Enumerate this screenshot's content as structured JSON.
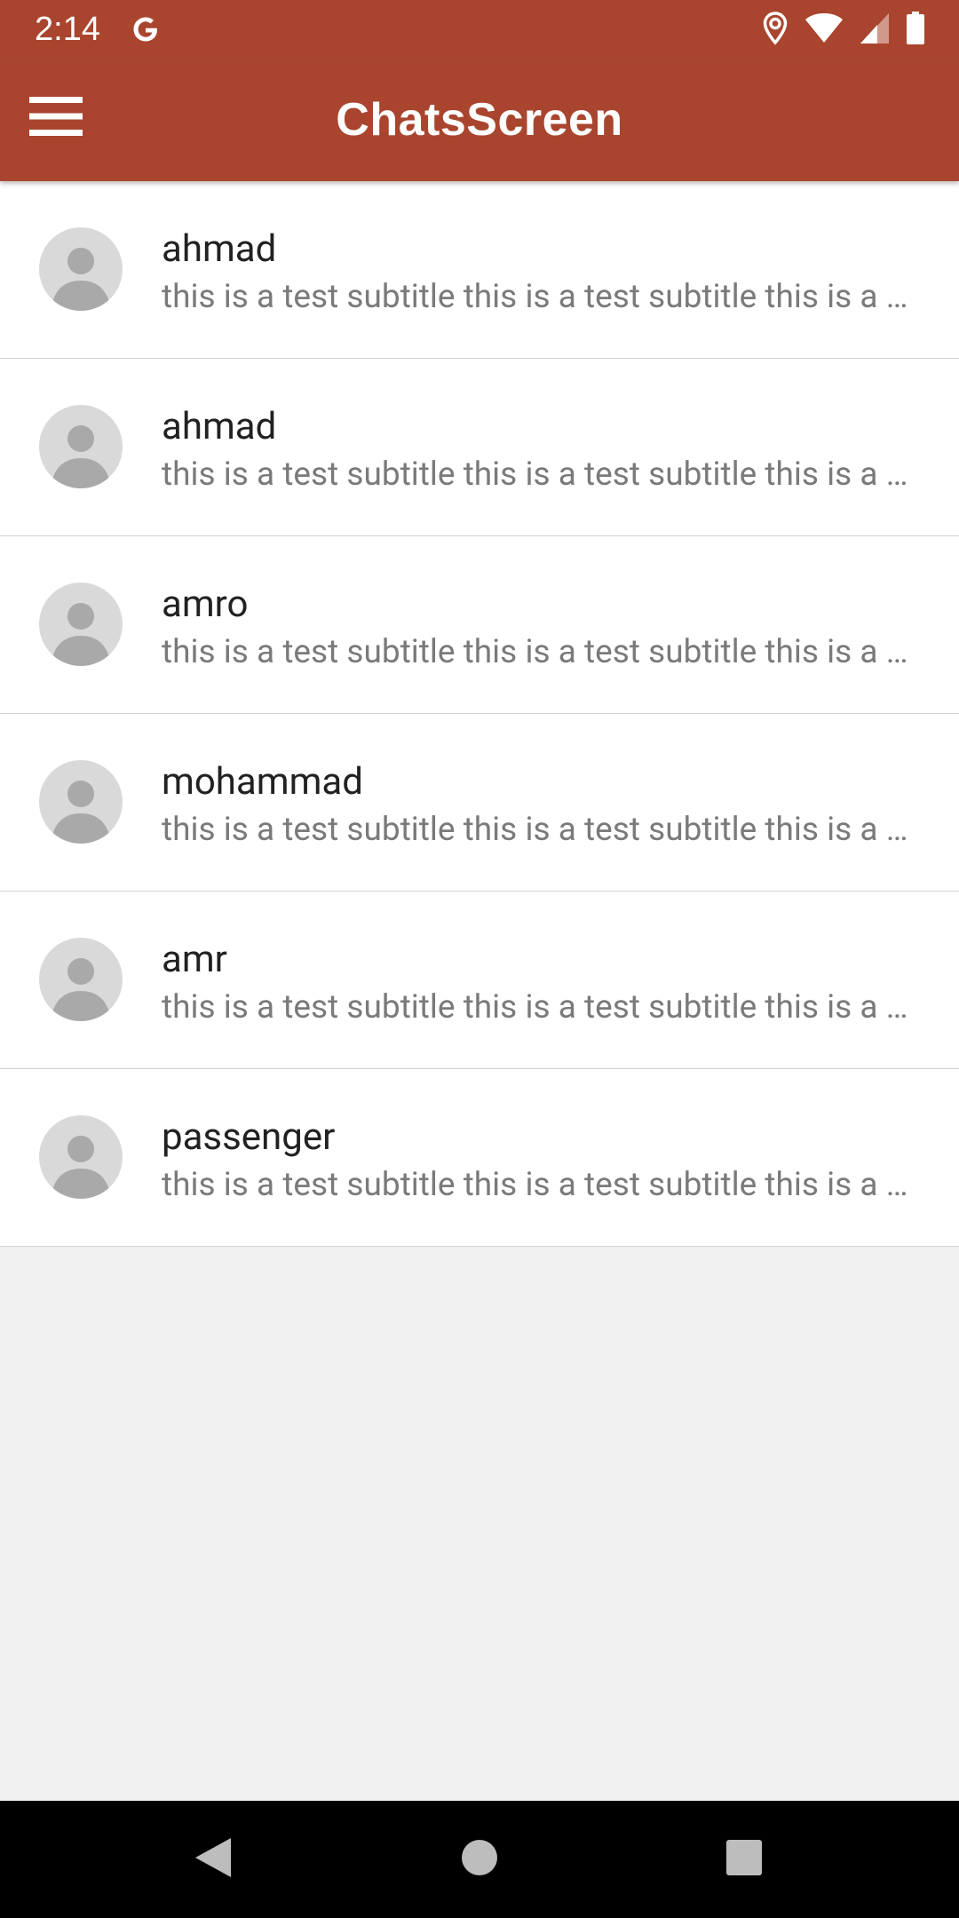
{
  "status_bar": {
    "time": "2:14",
    "google_icon": "google-g-icon",
    "icons": [
      "location-icon",
      "wifi-icon",
      "cellular-signal-icon",
      "battery-icon"
    ]
  },
  "app_bar": {
    "title": "ChatsScreen",
    "menu_icon": "hamburger-menu-icon",
    "background_color": "#a9452e"
  },
  "chats": [
    {
      "name": "ahmad",
      "subtitle": "this is a test subtitle this is a test subtitle this is a test subtitle"
    },
    {
      "name": "ahmad",
      "subtitle": "this is a test subtitle this is a test subtitle this is a test subtitle"
    },
    {
      "name": "amro",
      "subtitle": "this is a test subtitle this is a test subtitle this is a test subtitle"
    },
    {
      "name": "mohammad",
      "subtitle": "this is a test subtitle this is a test subtitle this is a test subtitle"
    },
    {
      "name": "amr",
      "subtitle": "this is a test subtitle this is a test subtitle this is a test subtitle"
    },
    {
      "name": "passenger",
      "subtitle": "this is a test subtitle this is a test subtitle this is a test subtitle"
    }
  ],
  "nav_bar": {
    "buttons": [
      "back-icon",
      "home-icon",
      "recents-icon"
    ]
  }
}
